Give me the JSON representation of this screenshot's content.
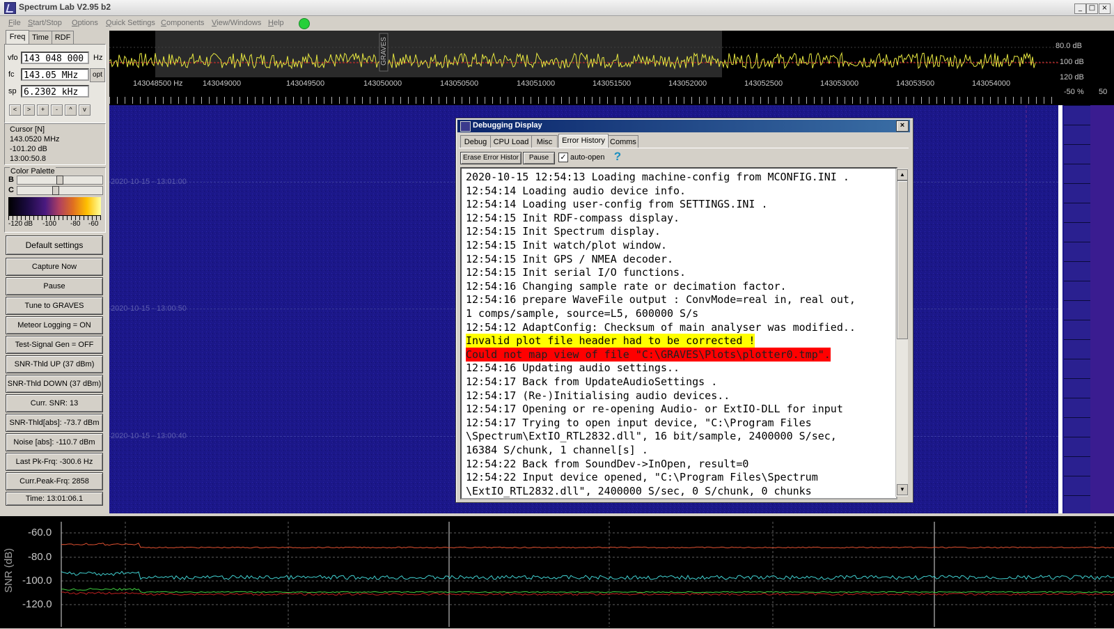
{
  "window": {
    "title": "Spectrum Lab V2.95 b2",
    "min": "_",
    "max": "□",
    "close": "×"
  },
  "menu": [
    {
      "pre": "",
      "u": "F",
      "post": "ile"
    },
    {
      "pre": "",
      "u": "S",
      "post": "tart/Stop"
    },
    {
      "pre": "",
      "u": "O",
      "post": "ptions"
    },
    {
      "pre": "",
      "u": "Q",
      "post": "uick Settings"
    },
    {
      "pre": "",
      "u": "C",
      "post": "omponents"
    },
    {
      "pre": "",
      "u": "V",
      "post": "iew/Windows"
    },
    {
      "pre": "",
      "u": "H",
      "post": "elp"
    }
  ],
  "run_indicator": {
    "symbol": "●",
    "color": "#26d03a"
  },
  "left": {
    "tabs": [
      "Freq",
      "Time",
      "RDF"
    ],
    "vfo_label": "vfo",
    "vfo_value": "143 048 000",
    "vfo_unit": "Hz",
    "fc_label": "fc",
    "fc_value": "143.05 MHz",
    "opt": "opt",
    "sp_label": "sp",
    "sp_value": "6.2302 kHz",
    "nav_buttons": [
      "<",
      ">",
      "+",
      "-",
      "^",
      "v"
    ],
    "cursor": {
      "title": "Cursor [N]",
      "freq": "143.0520 MHz",
      "level": "-101.20 dB",
      "time": "13:00:50.8"
    },
    "palette": {
      "title": "Color Palette",
      "b": "B",
      "c": "C",
      "b_pos": 0.5,
      "c_pos": 0.45,
      "scale": [
        "-120 dB",
        "-100",
        "-80",
        "-60"
      ]
    },
    "buttons": [
      "Default settings",
      "Capture Now",
      "Pause",
      "Tune to GRAVES",
      "Meteor Logging = ON",
      "Test-Signal Gen = OFF",
      "SNR-Thld UP (37 dBm)",
      "SNR-Thld DOWN (37 dBm)",
      "Curr. SNR: 13",
      "SNR-Thld[abs]: -73.7 dBm",
      "Noise [abs]: -110.7 dBm",
      "Last Pk-Frq: -300.6 Hz",
      "Curr.Peak-Frq: 2858",
      "Time:  13:01:06.1"
    ]
  },
  "spectrum": {
    "marker_label": "GRAVES",
    "db_scale": [
      "80.0 dB",
      "100 dB",
      "120 dB"
    ],
    "percent_label": "-50 %",
    "percent_value": "50",
    "freq_ticks": [
      "143048500 Hz",
      "143049000",
      "143049500",
      "143050000",
      "143050500",
      "143051000",
      "143051500",
      "143052000",
      "143052500",
      "143053000",
      "143053500",
      "143054000"
    ]
  },
  "waterfall": {
    "timestamps": [
      "2020-10-15 - 13:01:00",
      "2020-10-15 - 13:00:50",
      "2020-10-15 - 13:00:40"
    ]
  },
  "plot": {
    "ylabel": "SNR (dB)",
    "yticks": [
      "-60.0",
      "-80.0",
      "-100.0",
      "-120.0"
    ],
    "colors": {
      "top": "#e05030",
      "mid": "#40d0d0",
      "low": "#40d040",
      "noise": "#c02020"
    }
  },
  "dialog": {
    "title": "Debugging Display",
    "close": "×",
    "tabs": [
      "Debug",
      "CPU Load",
      "Misc",
      "Error History",
      "Comms"
    ],
    "active_tab": "Error History",
    "erase_btn": "Erase Error Histor",
    "pause_btn": "Pause",
    "autoopen_label": "auto-open",
    "autoopen_checked": true,
    "help_icon": "?",
    "log_lines": [
      {
        "text": "2020-10-15 12:54:13 Loading machine-config from MCONFIG.INI .",
        "hl": ""
      },
      {
        "text": "12:54:14 Loading audio device info.",
        "hl": ""
      },
      {
        "text": "12:54:14 Loading user-config from SETTINGS.INI .",
        "hl": ""
      },
      {
        "text": "12:54:15 Init RDF-compass display.",
        "hl": ""
      },
      {
        "text": "12:54:15 Init Spectrum display.",
        "hl": ""
      },
      {
        "text": "12:54:15 Init watch/plot window.",
        "hl": ""
      },
      {
        "text": "12:54:15 Init GPS / NMEA decoder.",
        "hl": ""
      },
      {
        "text": "12:54:15 Init serial I/O functions.",
        "hl": ""
      },
      {
        "text": "12:54:16 Changing sample rate or decimation factor.",
        "hl": ""
      },
      {
        "text": "12:54:16 prepare WaveFile output : ConvMode=real in, real out,",
        "hl": ""
      },
      {
        "text": "1 comps/sample, source=L5, 600000 S/s",
        "hl": ""
      },
      {
        "text": "12:54:12 AdaptConfig: Checksum of main analyser was modified..",
        "hl": ""
      },
      {
        "text": "Invalid plot file header had to be corrected !",
        "hl": "yellow"
      },
      {
        "text": "Could not map view of file \"C:\\GRAVES\\Plots\\plotter0.tmp\".",
        "hl": "red"
      },
      {
        "text": "12:54:16 Updating audio settings..",
        "hl": ""
      },
      {
        "text": "12:54:17 Back from UpdateAudioSettings .",
        "hl": ""
      },
      {
        "text": "12:54:17 (Re-)Initialising audio devices..",
        "hl": ""
      },
      {
        "text": "12:54:17 Opening or re-opening Audio- or ExtIO-DLL for input",
        "hl": ""
      },
      {
        "text": "12:54:17 Trying to open input device, \"C:\\Program Files",
        "hl": ""
      },
      {
        "text": "\\Spectrum\\ExtIO_RTL2832.dll\", 16 bit/sample, 2400000 S/sec,",
        "hl": ""
      },
      {
        "text": "16384 S/chunk, 1 channel[s] .",
        "hl": ""
      },
      {
        "text": "12:54:22 Back from SoundDev->InOpen, result=0",
        "hl": ""
      },
      {
        "text": "12:54:22 Input device opened, \"C:\\Program Files\\Spectrum",
        "hl": ""
      },
      {
        "text": "\\ExtIO_RTL2832.dll\", 2400000 S/sec, 0 S/chunk, 0 chunks",
        "hl": ""
      }
    ],
    "scroll": {
      "up": "▲",
      "down": "▼"
    }
  }
}
